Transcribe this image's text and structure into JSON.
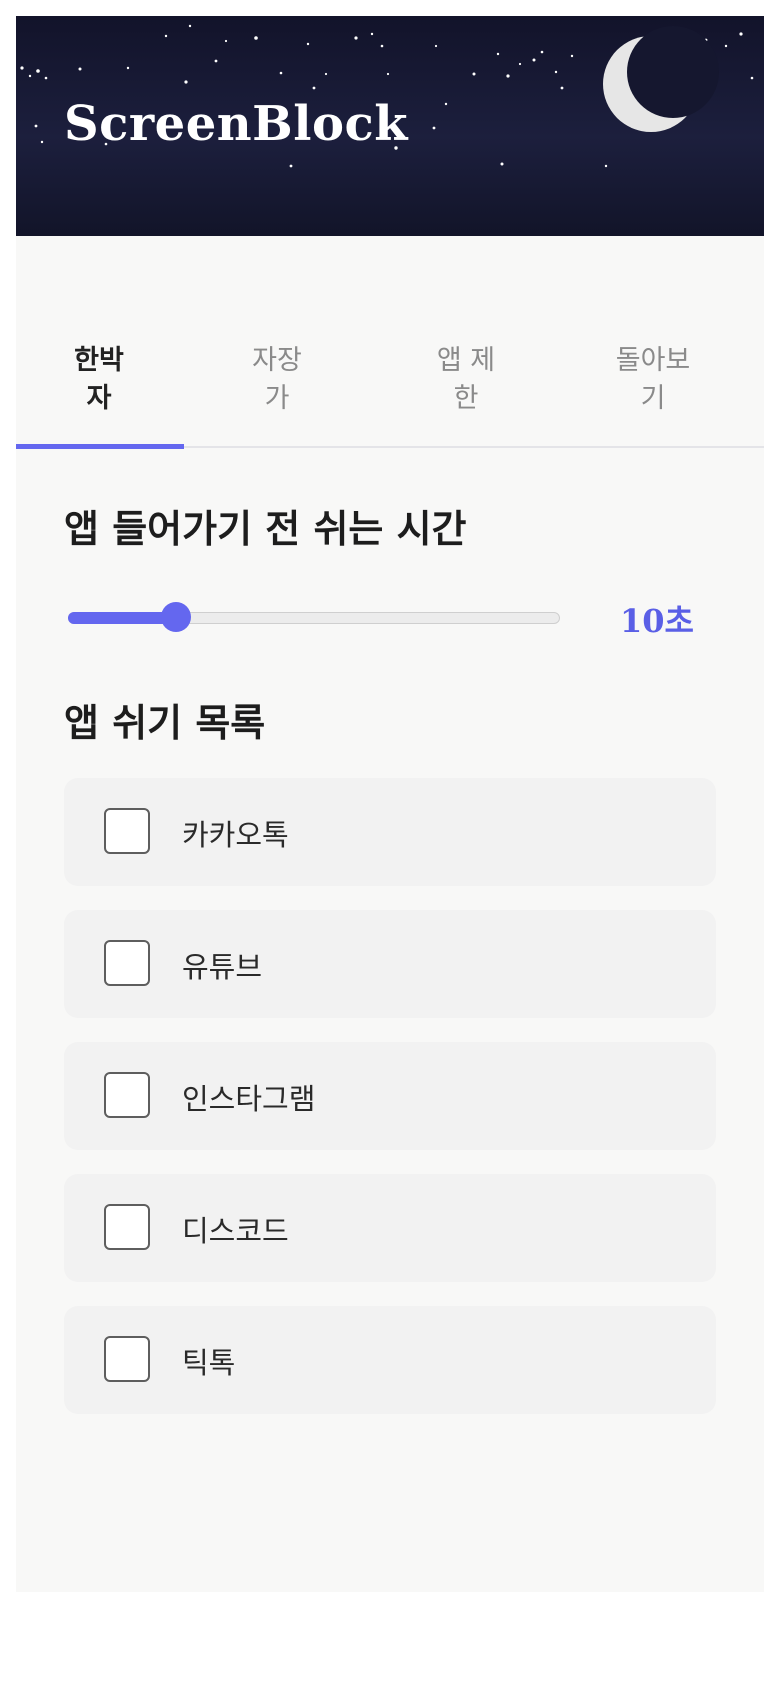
{
  "header": {
    "title": "ScreenBlock",
    "moon_icon": "crescent-moon-icon"
  },
  "tabs": [
    {
      "label_line1": "한박",
      "label_line2": "자",
      "active": true
    },
    {
      "label_line1": "자장",
      "label_line2": "가",
      "active": false
    },
    {
      "label_line1": "앱 제",
      "label_line2": "한",
      "active": false
    },
    {
      "label_line1": "돌아보",
      "label_line2": "기",
      "active": false
    }
  ],
  "break_time": {
    "title": "앱 들어가기 전 쉬는 시간",
    "value_label": "10초",
    "slider_fraction": 0.22
  },
  "app_list": {
    "title": "앱 쉬기 목록",
    "items": [
      {
        "label": "카카오톡",
        "checked": false
      },
      {
        "label": "유튜브",
        "checked": false
      },
      {
        "label": "인스타그램",
        "checked": false
      },
      {
        "label": "디스코드",
        "checked": false
      },
      {
        "label": "틱톡",
        "checked": false
      }
    ]
  },
  "colors": {
    "accent": "#6467ef",
    "header_bg": "#15172f"
  }
}
